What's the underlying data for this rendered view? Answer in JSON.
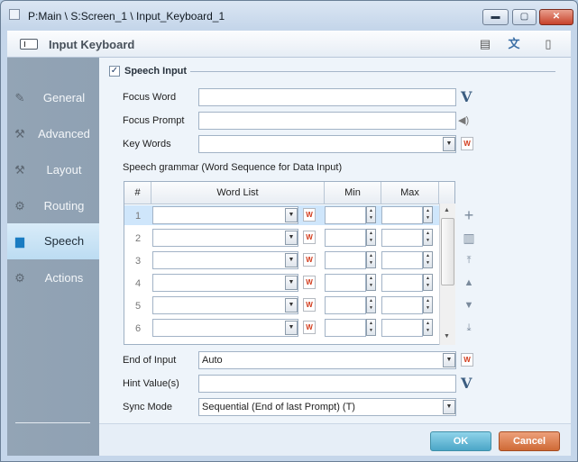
{
  "window": {
    "title": "P:Main \\ S:Screen_1 \\ Input_Keyboard_1",
    "min_glyph": "▬",
    "max_glyph": "▢",
    "close_glyph": "✕"
  },
  "header": {
    "title": "Input Keyboard"
  },
  "sidebar": {
    "items": [
      {
        "label": "General",
        "icon": "pencil-icon"
      },
      {
        "label": "Advanced",
        "icon": "wrench-icon"
      },
      {
        "label": "Layout",
        "icon": "tools-icon"
      },
      {
        "label": "Routing",
        "icon": "gear-icon"
      },
      {
        "label": "Speech",
        "icon": "speech-bubble-icon",
        "active": true
      },
      {
        "label": "Actions",
        "icon": "actions-icon"
      }
    ]
  },
  "speech_input": {
    "label": "Speech Input",
    "checked": true
  },
  "fields": {
    "focus_word": {
      "label": "Focus Word",
      "value": ""
    },
    "focus_prompt": {
      "label": "Focus Prompt",
      "value": ""
    },
    "key_words": {
      "label": "Key Words",
      "value": ""
    }
  },
  "grammar": {
    "label": "Speech grammar (Word Sequence for Data Input)",
    "columns": [
      "#",
      "Word List",
      "Min",
      "Max"
    ],
    "rows": [
      {
        "num": "1",
        "word_list": "",
        "min": "",
        "max": ""
      },
      {
        "num": "2",
        "word_list": "",
        "min": "",
        "max": ""
      },
      {
        "num": "3",
        "word_list": "",
        "min": "",
        "max": ""
      },
      {
        "num": "4",
        "word_list": "",
        "min": "",
        "max": ""
      },
      {
        "num": "5",
        "word_list": "",
        "min": "",
        "max": ""
      },
      {
        "num": "6",
        "word_list": "",
        "min": "",
        "max": ""
      }
    ]
  },
  "end_of_input": {
    "label": "End of Input",
    "value": "Auto"
  },
  "hint_values": {
    "label": "Hint Value(s)",
    "value": ""
  },
  "sync_mode": {
    "label": "Sync Mode",
    "value": "Sequential (End of last Prompt) (T)"
  },
  "buttons": {
    "ok": "OK",
    "cancel": "Cancel"
  },
  "glyphs": {
    "v": "V",
    "w": "W",
    "drop": "▼",
    "up": "▲",
    "down": "▼",
    "speaker": "◀)",
    "check": "✓"
  },
  "colors": {
    "accent_ok": "#4ba6c7",
    "accent_cancel": "#cf6a36",
    "sidebar_active": "#bcdcf2"
  }
}
